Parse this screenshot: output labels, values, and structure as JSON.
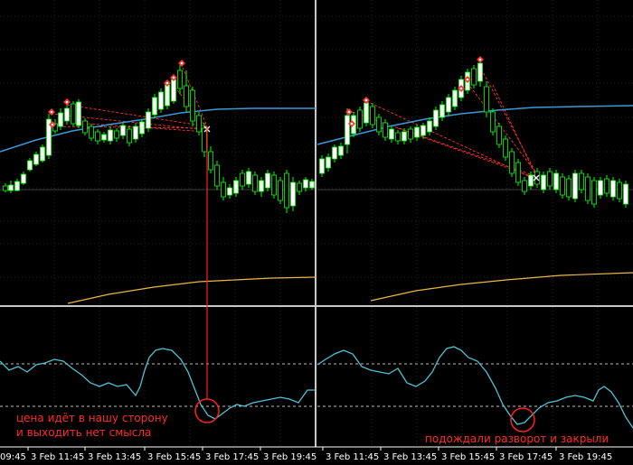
{
  "chart_data": [
    {
      "type": "candlestick",
      "panel": "left",
      "x_ticks": [
        "09:45",
        "3 Feb 11:45",
        "3 Feb 13:45",
        "3 Feb 15:45",
        "3 Feb 17:45",
        "3 Feb 19:45"
      ],
      "annotation_lines": [
        "цена идёт в нашу сторону",
        "и выходить нет смысла"
      ]
    },
    {
      "type": "candlestick",
      "panel": "right",
      "x_ticks": [
        "3 Feb 11:45",
        "3 Feb 13:45",
        "3 Feb 15:45",
        "3 Feb 17:45",
        "3 Feb 19:45"
      ],
      "annotation_lines": [
        "подождали разворот и закрыли"
      ]
    }
  ],
  "colors": {
    "background": "#000000",
    "bull_body": "#ffffff",
    "bear_body": "#000000",
    "wick": "#00ff00",
    "moving_average": "#3a9ad9",
    "trend_line": "#e8b84a",
    "oscillator": "#4fc3d6",
    "marker": "#ff3030",
    "annotation": "#ff2a2a"
  }
}
